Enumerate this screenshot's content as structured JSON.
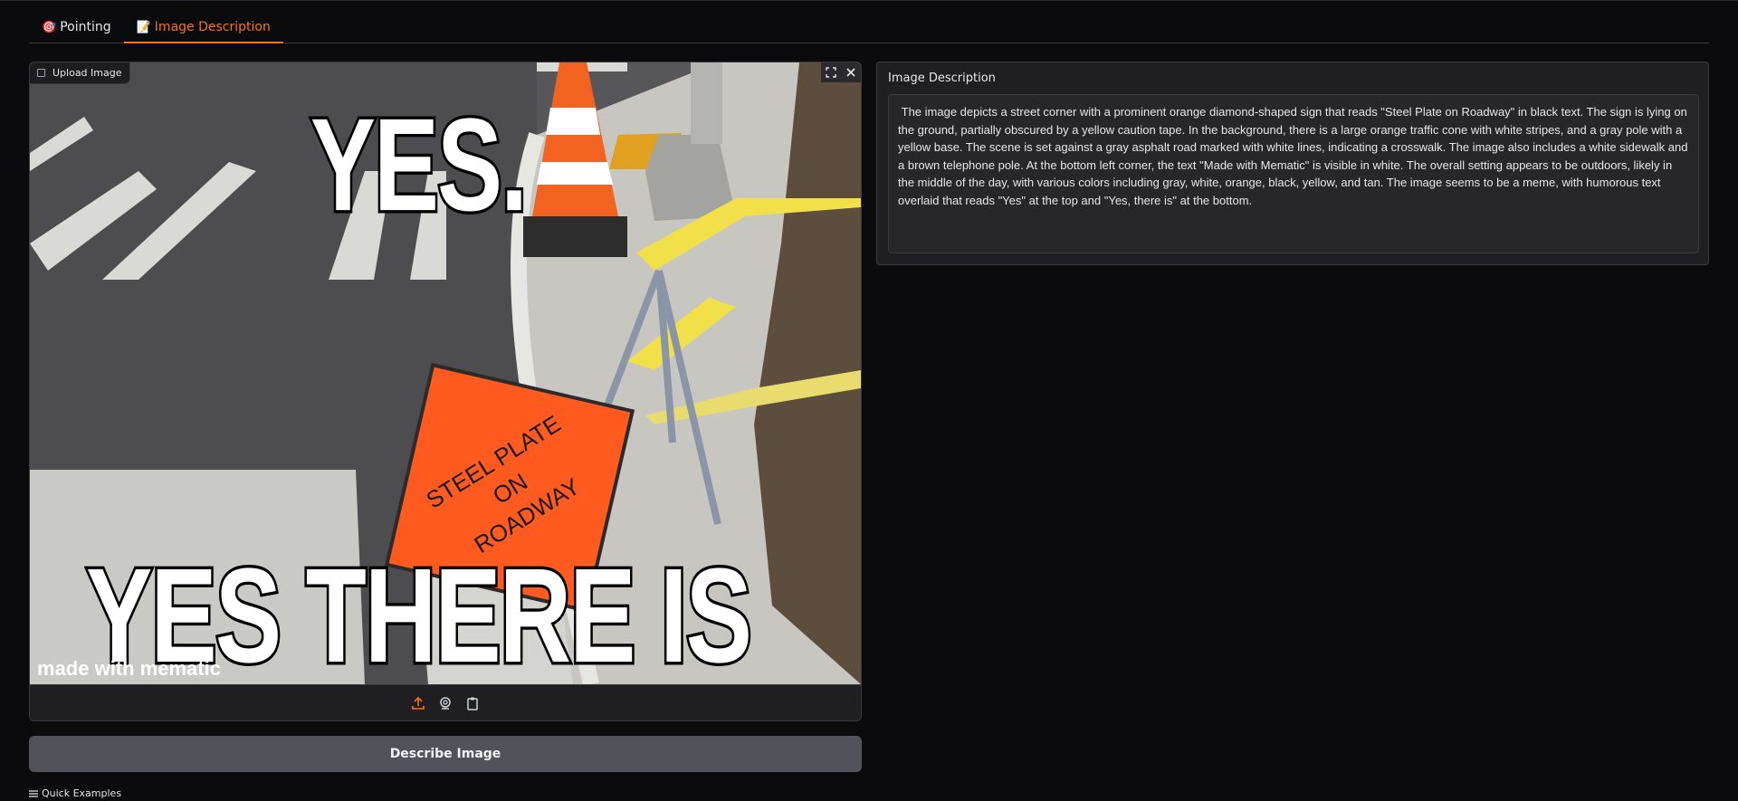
{
  "tabs": [
    {
      "icon": "🎯",
      "label": "Pointing",
      "active": false
    },
    {
      "icon": "📝",
      "label": "Image Description",
      "active": true
    }
  ],
  "image_input": {
    "label": "Upload Image",
    "meme_top_text": "YES.",
    "meme_bottom_text": "YES THERE IS",
    "watermark": "made with mematic",
    "sign_text": [
      "STEEL PLATE",
      "ON",
      "ROADWAY"
    ],
    "toolbar_icons": [
      "upload-icon",
      "webcam-icon",
      "clipboard-icon"
    ]
  },
  "describe_button": {
    "label": "Describe Image"
  },
  "quick_examples": {
    "label": "Quick Examples"
  },
  "description": {
    "label": "Image Description",
    "text": " The image depicts a street corner with a prominent orange diamond-shaped sign that reads \"Steel Plate on Roadway\" in black text. The sign is lying on the ground, partially obscured by a yellow caution tape. In the background, there is a large orange traffic cone with white stripes, and a gray pole with a yellow base. The scene is set against a gray asphalt road marked with white lines, indicating a crosswalk. The image also includes a white sidewalk and a brown telephone pole. At the bottom left corner, the text \"Made with Mematic\" is visible in white. The overall setting appears to be outdoors, likely in the middle of the day, with various colors including gray, white, orange, black, yellow, and tan. The image seems to be a meme, with humorous text overlaid that reads \"Yes\" at the top and \"Yes, there is\" at the bottom."
  },
  "colors": {
    "accent": "#f97316",
    "background": "#0b0b0d",
    "panel": "#1f1f23",
    "button": "#52525b"
  }
}
